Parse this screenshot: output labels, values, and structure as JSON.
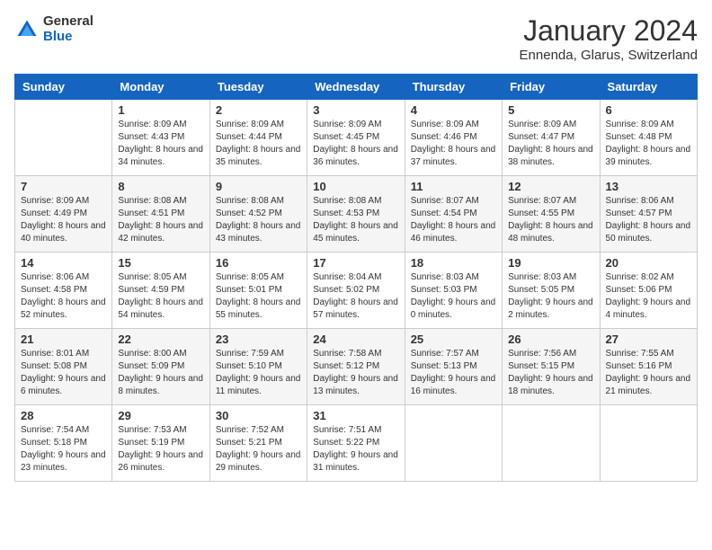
{
  "header": {
    "logo_general": "General",
    "logo_blue": "Blue",
    "month_title": "January 2024",
    "location": "Ennenda, Glarus, Switzerland"
  },
  "weekdays": [
    "Sunday",
    "Monday",
    "Tuesday",
    "Wednesday",
    "Thursday",
    "Friday",
    "Saturday"
  ],
  "weeks": [
    [
      {
        "day": null
      },
      {
        "day": "1",
        "sunrise": "8:09 AM",
        "sunset": "4:43 PM",
        "daylight": "8 hours and 34 minutes."
      },
      {
        "day": "2",
        "sunrise": "8:09 AM",
        "sunset": "4:44 PM",
        "daylight": "8 hours and 35 minutes."
      },
      {
        "day": "3",
        "sunrise": "8:09 AM",
        "sunset": "4:45 PM",
        "daylight": "8 hours and 36 minutes."
      },
      {
        "day": "4",
        "sunrise": "8:09 AM",
        "sunset": "4:46 PM",
        "daylight": "8 hours and 37 minutes."
      },
      {
        "day": "5",
        "sunrise": "8:09 AM",
        "sunset": "4:47 PM",
        "daylight": "8 hours and 38 minutes."
      },
      {
        "day": "6",
        "sunrise": "8:09 AM",
        "sunset": "4:48 PM",
        "daylight": "8 hours and 39 minutes."
      }
    ],
    [
      {
        "day": "7",
        "sunrise": "8:09 AM",
        "sunset": "4:49 PM",
        "daylight": "8 hours and 40 minutes."
      },
      {
        "day": "8",
        "sunrise": "8:08 AM",
        "sunset": "4:51 PM",
        "daylight": "8 hours and 42 minutes."
      },
      {
        "day": "9",
        "sunrise": "8:08 AM",
        "sunset": "4:52 PM",
        "daylight": "8 hours and 43 minutes."
      },
      {
        "day": "10",
        "sunrise": "8:08 AM",
        "sunset": "4:53 PM",
        "daylight": "8 hours and 45 minutes."
      },
      {
        "day": "11",
        "sunrise": "8:07 AM",
        "sunset": "4:54 PM",
        "daylight": "8 hours and 46 minutes."
      },
      {
        "day": "12",
        "sunrise": "8:07 AM",
        "sunset": "4:55 PM",
        "daylight": "8 hours and 48 minutes."
      },
      {
        "day": "13",
        "sunrise": "8:06 AM",
        "sunset": "4:57 PM",
        "daylight": "8 hours and 50 minutes."
      }
    ],
    [
      {
        "day": "14",
        "sunrise": "8:06 AM",
        "sunset": "4:58 PM",
        "daylight": "8 hours and 52 minutes."
      },
      {
        "day": "15",
        "sunrise": "8:05 AM",
        "sunset": "4:59 PM",
        "daylight": "8 hours and 54 minutes."
      },
      {
        "day": "16",
        "sunrise": "8:05 AM",
        "sunset": "5:01 PM",
        "daylight": "8 hours and 55 minutes."
      },
      {
        "day": "17",
        "sunrise": "8:04 AM",
        "sunset": "5:02 PM",
        "daylight": "8 hours and 57 minutes."
      },
      {
        "day": "18",
        "sunrise": "8:03 AM",
        "sunset": "5:03 PM",
        "daylight": "9 hours and 0 minutes."
      },
      {
        "day": "19",
        "sunrise": "8:03 AM",
        "sunset": "5:05 PM",
        "daylight": "9 hours and 2 minutes."
      },
      {
        "day": "20",
        "sunrise": "8:02 AM",
        "sunset": "5:06 PM",
        "daylight": "9 hours and 4 minutes."
      }
    ],
    [
      {
        "day": "21",
        "sunrise": "8:01 AM",
        "sunset": "5:08 PM",
        "daylight": "9 hours and 6 minutes."
      },
      {
        "day": "22",
        "sunrise": "8:00 AM",
        "sunset": "5:09 PM",
        "daylight": "9 hours and 8 minutes."
      },
      {
        "day": "23",
        "sunrise": "7:59 AM",
        "sunset": "5:10 PM",
        "daylight": "9 hours and 11 minutes."
      },
      {
        "day": "24",
        "sunrise": "7:58 AM",
        "sunset": "5:12 PM",
        "daylight": "9 hours and 13 minutes."
      },
      {
        "day": "25",
        "sunrise": "7:57 AM",
        "sunset": "5:13 PM",
        "daylight": "9 hours and 16 minutes."
      },
      {
        "day": "26",
        "sunrise": "7:56 AM",
        "sunset": "5:15 PM",
        "daylight": "9 hours and 18 minutes."
      },
      {
        "day": "27",
        "sunrise": "7:55 AM",
        "sunset": "5:16 PM",
        "daylight": "9 hours and 21 minutes."
      }
    ],
    [
      {
        "day": "28",
        "sunrise": "7:54 AM",
        "sunset": "5:18 PM",
        "daylight": "9 hours and 23 minutes."
      },
      {
        "day": "29",
        "sunrise": "7:53 AM",
        "sunset": "5:19 PM",
        "daylight": "9 hours and 26 minutes."
      },
      {
        "day": "30",
        "sunrise": "7:52 AM",
        "sunset": "5:21 PM",
        "daylight": "9 hours and 29 minutes."
      },
      {
        "day": "31",
        "sunrise": "7:51 AM",
        "sunset": "5:22 PM",
        "daylight": "9 hours and 31 minutes."
      },
      {
        "day": null
      },
      {
        "day": null
      },
      {
        "day": null
      }
    ]
  ]
}
